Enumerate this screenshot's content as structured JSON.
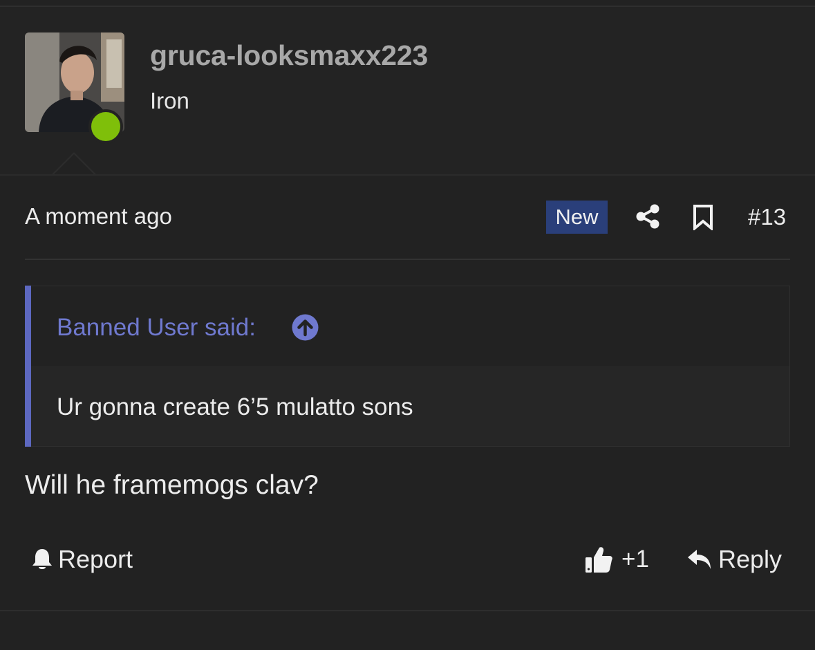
{
  "user": {
    "username": "gruca-looksmaxx223",
    "title": "Iron",
    "online": true
  },
  "meta": {
    "timestamp": "A moment ago",
    "badge": "New",
    "post_number": "#13"
  },
  "quote": {
    "author": "Banned User said:",
    "text": "Ur gonna create 6’5 mulatto sons"
  },
  "message": "Will he framemogs clav?",
  "actions": {
    "report": "Report",
    "like_count": "+1",
    "reply": "Reply"
  },
  "colors": {
    "background": "#222222",
    "accent": "#6f79cf",
    "badge": "#2a3f7a",
    "online": "#7fbf0a"
  }
}
